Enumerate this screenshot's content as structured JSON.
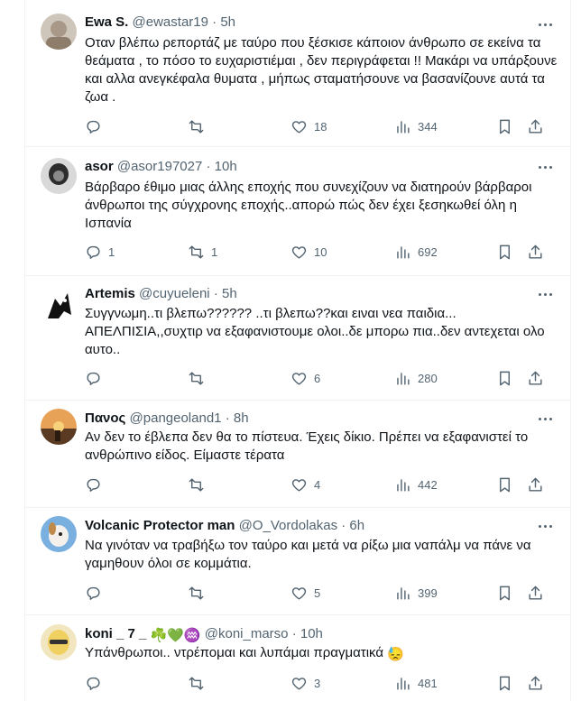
{
  "tweets": [
    {
      "name": "Ewa S.",
      "handle": "@ewastar19",
      "dot": "·",
      "time": "5h",
      "text": "Οταν βλέπω ρεπορτάζ με ταύρο που ξέσκισε κάποιον άνθρωπο σε εκείνα τα θεάματα , το πόσο το ευχαριστιέμαι , δεν περιγράφεται !! Μακάρι να υπάρξουνε και αλλα ανεγκέφαλα θυματα , μήπως σταματήσουνε να βασανίζουνε αυτά τα ζωα .",
      "replies": "",
      "retweets": "",
      "likes": "18",
      "views": "344",
      "avatar_color": "#c9bfb3"
    },
    {
      "name": "asor",
      "handle": "@asor197027",
      "dot": "·",
      "time": "10h",
      "text": "Βάρβαρο έθιμο μιας άλλης εποχής που συνεχίζουν να διατηρούν βάρβαροι άνθρωποι της σύγχρονης εποχής..απορώ πώς δεν έχει ξεσηκωθεί όλη η Ισπανία",
      "replies": "1",
      "retweets": "1",
      "likes": "10",
      "views": "692",
      "avatar_color": "#3a3a3a"
    },
    {
      "name": "Artemis",
      "handle": "@cuyueleni",
      "dot": "·",
      "time": "5h",
      "text": "Συγγνωμη..τι βλεπω?????? ..τι βλεπω??και ειναι νεα παιδια... ΑΠΕΛΠΙΣΙΑ,,συχτιρ να εξαφανιστουμε ολοι..δε μπορω πια..δεν αντεχεται ολο αυτο..",
      "replies": "",
      "retweets": "",
      "likes": "6",
      "views": "280",
      "avatar_color": "#ffffff"
    },
    {
      "name": "Πανος",
      "handle": "@pangeoland1",
      "dot": "·",
      "time": "8h",
      "text": "Αν δεν το έβλεπα δεν θα το πίστευα. Έχεις δίκιο. Πρέπει να εξαφανιστεί το ανθρώπινο είδος. Είμαστε τέρατα",
      "replies": "",
      "retweets": "",
      "likes": "4",
      "views": "442",
      "avatar_color": "#d98a3a"
    },
    {
      "name": "Volcanic Protector man",
      "handle": "@O_Vordolakas",
      "dot": "·",
      "time": "6h",
      "text": "Να γινόταν να τραβήξω τον ταύρο και μετά να ρίξω μια ναπάλμ να πάνε να γαμηθουν όλοι σε κομμάτια.",
      "replies": "",
      "retweets": "",
      "likes": "5",
      "views": "399",
      "avatar_color": "#6a9bd1"
    },
    {
      "name": "koni _ 7 _",
      "name_emojis": "☘️💚♒",
      "handle": "@koni_marso",
      "dot": "·",
      "time": "10h",
      "text": "Υπάνθρωποι..   ντρέπομαι και λυπάμαι πραγματικά",
      "text_emoji": "😓",
      "replies": "",
      "retweets": "",
      "likes": "3",
      "views": "481",
      "avatar_color": "#e8d9a8"
    }
  ],
  "icons": {
    "reply": "reply-icon",
    "retweet": "retweet-icon",
    "like": "heart-icon",
    "views": "views-chart-icon",
    "bookmark": "bookmark-icon",
    "share": "share-icon",
    "more": "more-icon"
  },
  "colors": {
    "text": "#0f1419",
    "secondary": "#536471",
    "border": "#eff3f4"
  }
}
